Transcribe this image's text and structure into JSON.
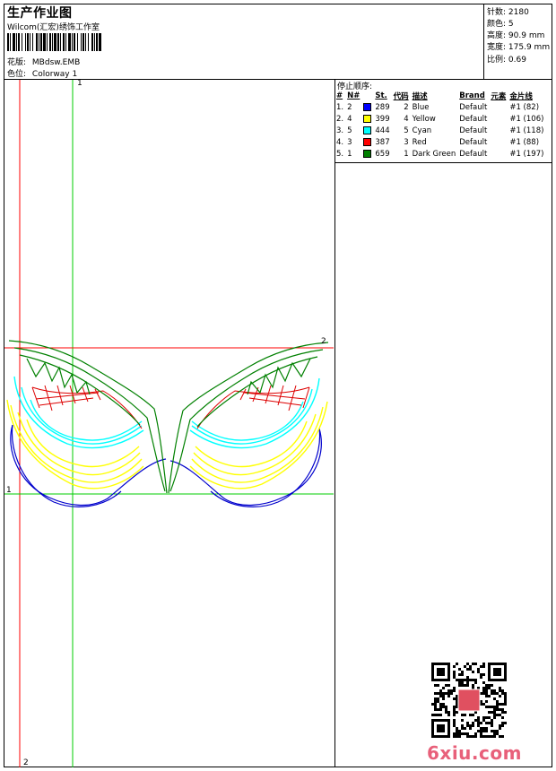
{
  "header": {
    "title": "生产作业图",
    "company": "Wilcom(汇宏)绣饰工作室",
    "design_label": "花版:",
    "design_value": "MBdsw.EMB",
    "colorway_label": "色位:",
    "colorway_value": "Colorway 1"
  },
  "stats": [
    {
      "label": "针数:",
      "value": "2180"
    },
    {
      "label": "颜色:",
      "value": "5"
    },
    {
      "label": "高度:",
      "value": "90.9 mm"
    },
    {
      "label": "宽度:",
      "value": "175.9 mm"
    },
    {
      "label": "比例:",
      "value": "0.69"
    }
  ],
  "sequence": {
    "title": "停止顺序:",
    "headers": [
      "#",
      "N#",
      "St.",
      "代码",
      "描述",
      "Brand",
      "元素",
      "金片线"
    ],
    "rows": [
      {
        "num": "1.",
        "n": "2",
        "color": "#0000ff",
        "st": "289",
        "code": "2",
        "desc": "Blue",
        "brand": "Default",
        "elem": "",
        "seq": "#1 (82)"
      },
      {
        "num": "2.",
        "n": "4",
        "color": "#ffff00",
        "st": "399",
        "code": "4",
        "desc": "Yellow",
        "brand": "Default",
        "elem": "",
        "seq": "#1 (106)"
      },
      {
        "num": "3.",
        "n": "5",
        "color": "#00ffff",
        "st": "444",
        "code": "5",
        "desc": "Cyan",
        "brand": "Default",
        "elem": "",
        "seq": "#1 (118)"
      },
      {
        "num": "4.",
        "n": "3",
        "color": "#ff0000",
        "st": "387",
        "code": "3",
        "desc": "Red",
        "brand": "Default",
        "elem": "",
        "seq": "#1 (88)"
      },
      {
        "num": "5.",
        "n": "1",
        "color": "#008000",
        "st": "659",
        "code": "1",
        "desc": "Dark Green",
        "brand": "Default",
        "elem": "",
        "seq": "#1 (197)"
      }
    ]
  },
  "guides": {
    "top_green_label": "1",
    "left_green_label": "1",
    "bottom_red_label": "2",
    "right_red_label": "2"
  },
  "colors": {
    "blue": "#0000cc",
    "yellow": "#ffff00",
    "cyan": "#00ffff",
    "red": "#dd0000",
    "green": "#008000",
    "guide_red": "#ff0000",
    "guide_green": "#00cc00"
  },
  "watermark": {
    "text": "6xiu.com"
  }
}
